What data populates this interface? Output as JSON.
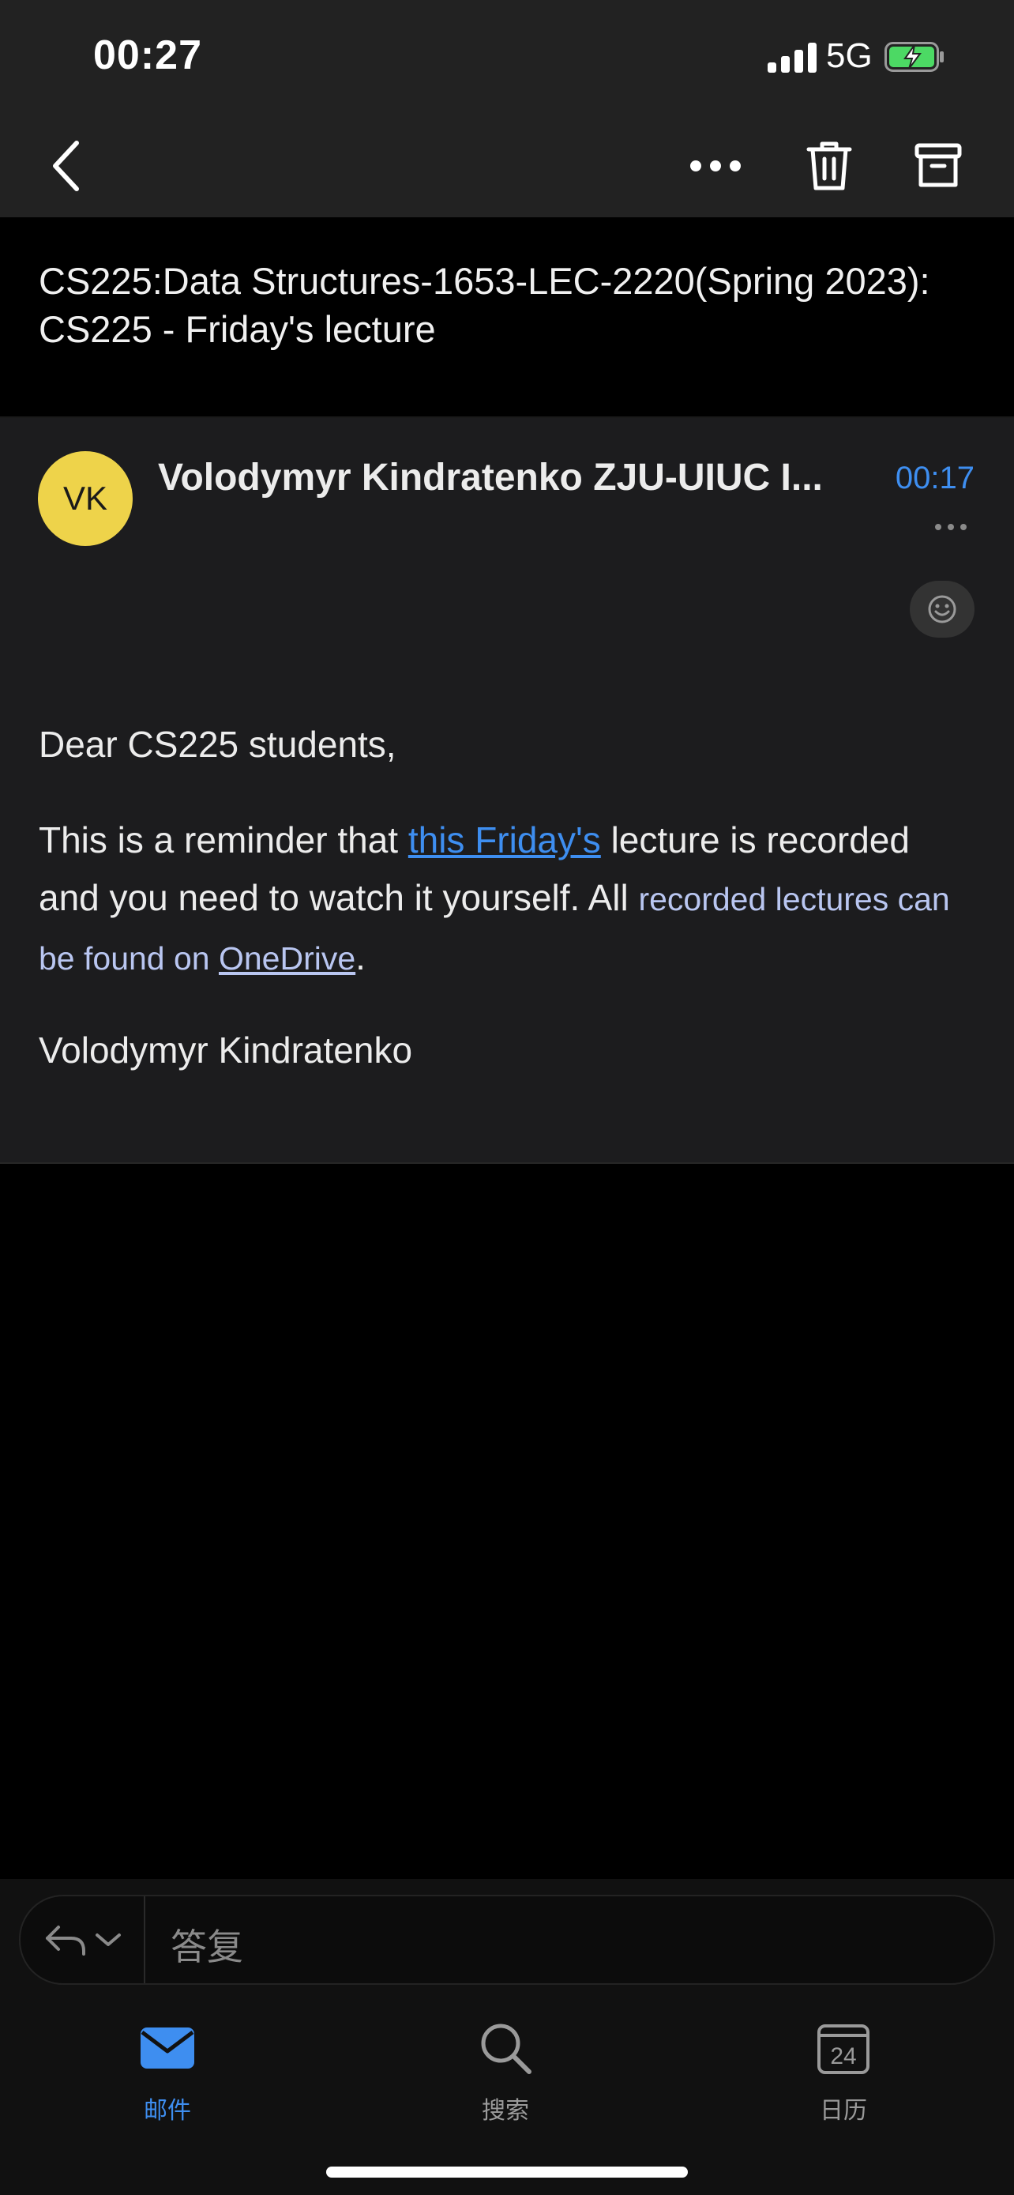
{
  "status_bar": {
    "time": "00:27",
    "network": "5G",
    "battery_charging": true
  },
  "toolbar": {
    "back_icon": "chevron-left-icon",
    "more_icon": "ellipsis-icon",
    "delete_icon": "trash-icon",
    "archive_icon": "archive-icon"
  },
  "email": {
    "subject": "CS225:Data Structures-1653-LEC-2220(Spring 2023): CS225 - Friday's lecture",
    "avatar_initials": "VK",
    "avatar_color": "#eed34a",
    "sender": "Volodymyr Kindratenko ZJU-UIUC I...",
    "time": "00:17",
    "body": {
      "greeting": "Dear CS225 students,",
      "reminder_prefix": "This is a reminder that ",
      "link_this_friday": "this Friday's",
      "reminder_middle": " lecture is recorded and you need to watch it yourself. All ",
      "recorded_lectures": "recorded lectures can be found on ",
      "link_onedrive": "OneDrive",
      "reminder_end": ".",
      "signature": "Volodymyr Kindratenko"
    }
  },
  "reply": {
    "placeholder": "答复"
  },
  "tabs": [
    {
      "label": "邮件",
      "icon": "mail-icon",
      "active": true
    },
    {
      "label": "搜索",
      "icon": "search-icon",
      "active": false
    },
    {
      "label": "日历",
      "icon": "calendar-icon",
      "active": false,
      "day": "24"
    }
  ],
  "colors": {
    "accent": "#3e8ef0",
    "background": "#000000",
    "card": "#1c1c1e"
  }
}
